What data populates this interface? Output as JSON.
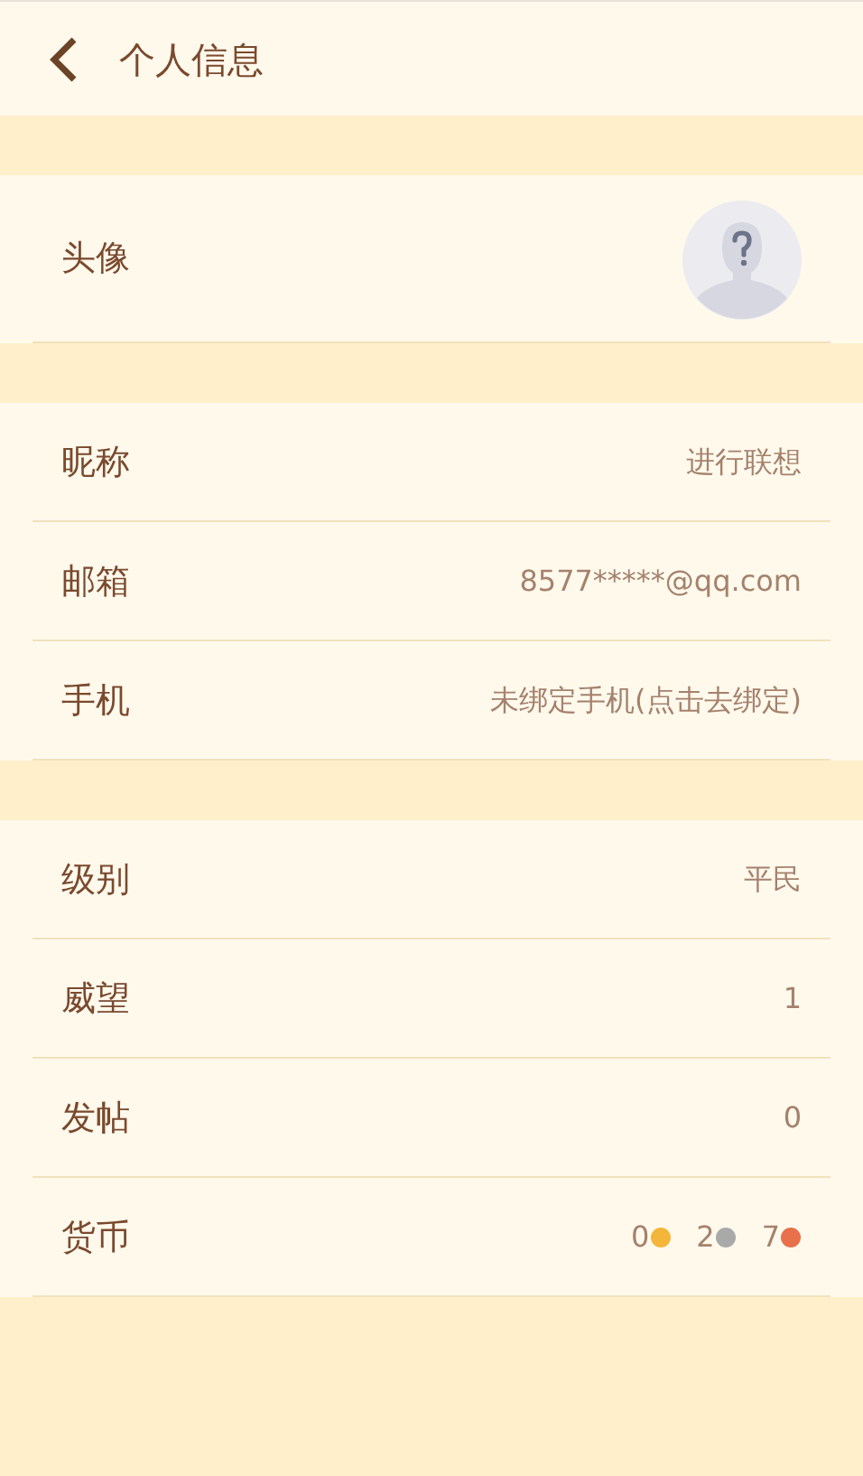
{
  "header": {
    "title": "个人信息"
  },
  "sections": [
    {
      "rows": [
        {
          "kind": "avatar",
          "label": "头像"
        }
      ]
    },
    {
      "rows": [
        {
          "kind": "text",
          "label": "昵称",
          "value": "进行联想"
        },
        {
          "kind": "text",
          "label": "邮箱",
          "value": "8577*****@qq.com"
        },
        {
          "kind": "text",
          "label": "手机",
          "value": "未绑定手机(点击去绑定)"
        }
      ]
    },
    {
      "rows": [
        {
          "kind": "text",
          "label": "级别",
          "value": "平民"
        },
        {
          "kind": "text",
          "label": "威望",
          "value": "1"
        },
        {
          "kind": "text",
          "label": "发帖",
          "value": "0"
        },
        {
          "kind": "coins",
          "label": "货币",
          "coins": [
            {
              "amount": "0",
              "color": "#f4b63a"
            },
            {
              "amount": "2",
              "color": "#a9a9a9"
            },
            {
              "amount": "7",
              "color": "#e8704a"
            }
          ]
        }
      ]
    }
  ]
}
